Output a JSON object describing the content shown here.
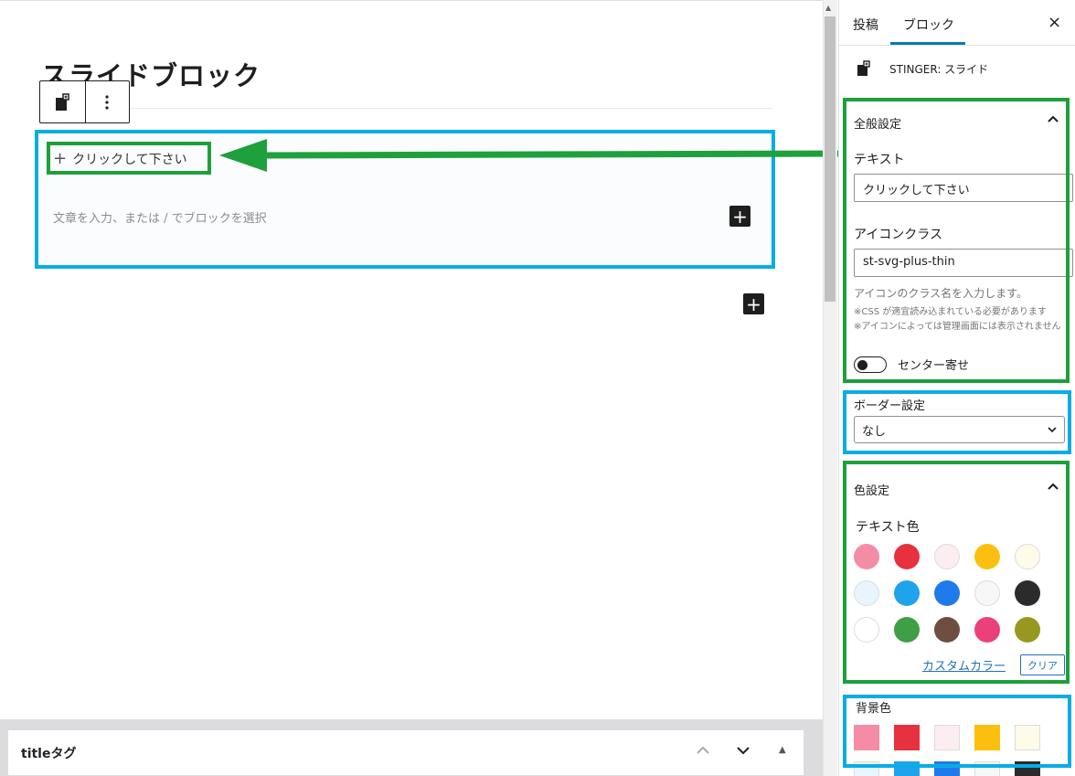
{
  "editor": {
    "post_title": "スライドブロック",
    "slide_trigger_text": "クリックして下さい",
    "paragraph_placeholder": "文章を入力、または / でブロックを選択"
  },
  "metabox": {
    "title": "titleタグ"
  },
  "sidebar": {
    "tabs": [
      {
        "label": "投稿"
      },
      {
        "label": "ブロック"
      }
    ],
    "active_tab": "ブロック",
    "close_icon": "×",
    "block_name": "STINGER: スライド",
    "general": {
      "title": "全般設定",
      "text_label": "テキスト",
      "text_value": "クリックして下さい",
      "icon_label": "アイコンクラス",
      "icon_value": "st-svg-plus-thin",
      "help_main": "アイコンのクラス名を入力します。",
      "help_note1": "※CSS が適宜読み込まれている必要があります",
      "help_note2": "※アイコンによっては管理画面には表示されません",
      "center_toggle_label": "センター寄せ",
      "center_toggle_on": false
    },
    "border": {
      "title": "ボーダー設定",
      "selected": "なし"
    },
    "color": {
      "title": "色設定",
      "text_color_label": "テキスト色",
      "palette": [
        "#f48ca6",
        "#e8313e",
        "#fcedf1",
        "#fdbf0f",
        "#fefbe8",
        "#e9f5fd",
        "#1ea3ec",
        "#1f7bec",
        "#f7f7f7",
        "#2b2b2b",
        "#ffffff",
        "#3f9f45",
        "#6e4e40",
        "#eb407a",
        "#989821"
      ],
      "custom_color_label": "カスタムカラー",
      "clear_label": "クリア",
      "bg_color_label": "背景色"
    }
  },
  "annotations": {
    "blue": "#0aace6",
    "green": "#1ea03c"
  }
}
